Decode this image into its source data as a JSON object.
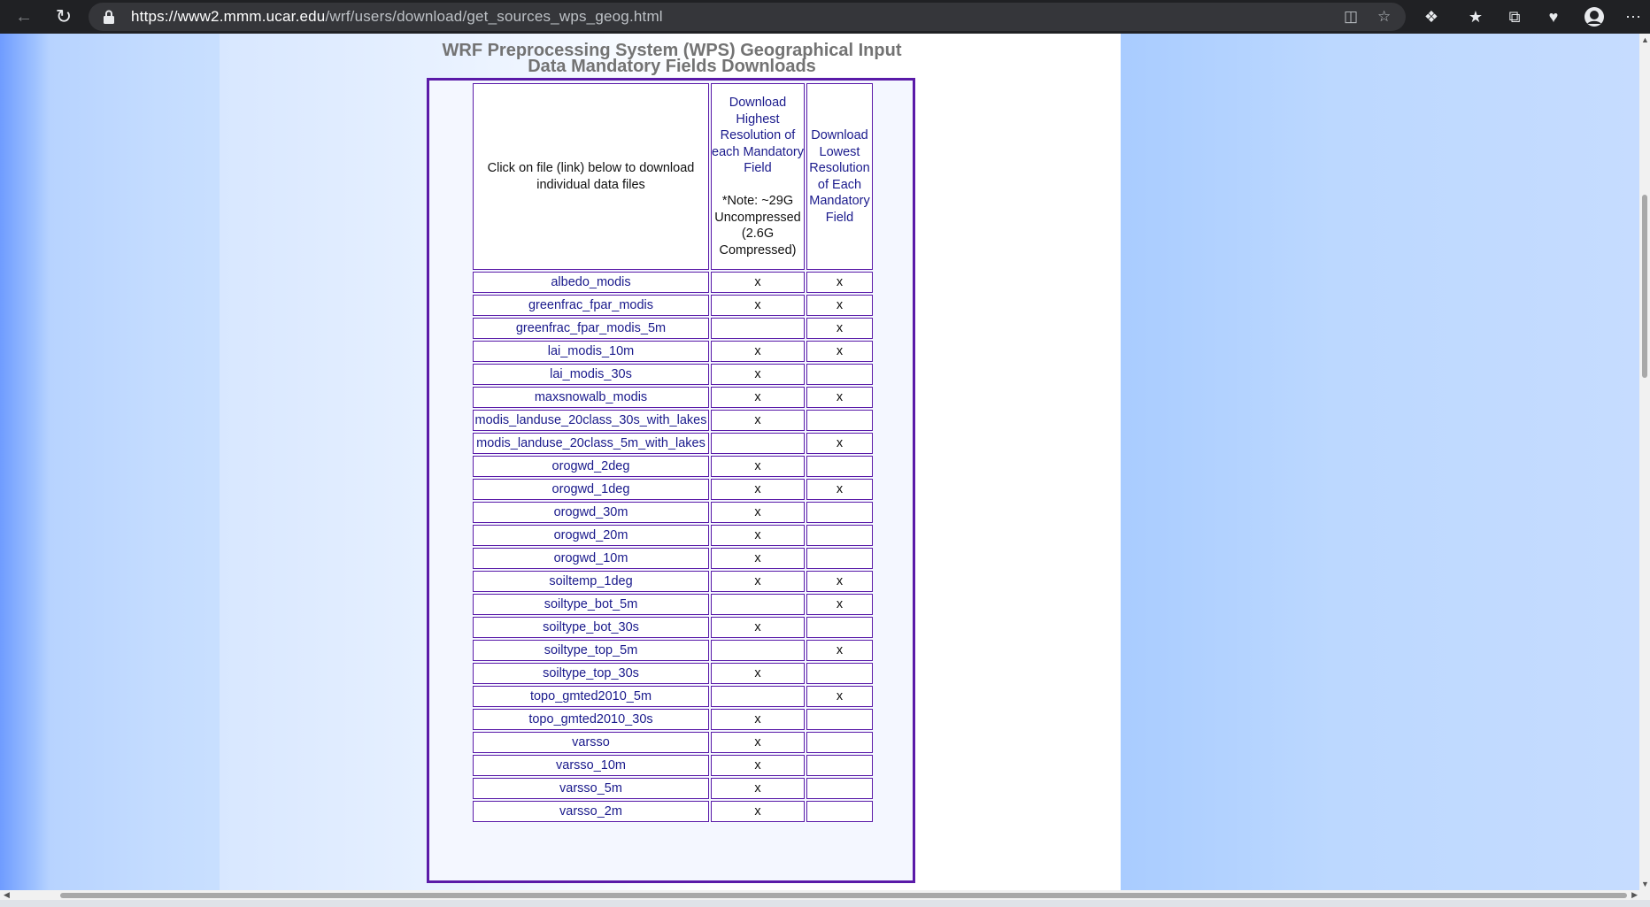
{
  "browser": {
    "url_host": "https://www2.mmm.ucar.edu",
    "url_path": "/wrf/users/download/get_sources_wps_geog.html"
  },
  "page": {
    "heading": "WRF Preprocessing System (WPS) Geographical Input Data Mandatory Fields Downloads",
    "table": {
      "header_file": "Click on file (link) below to download individual data files",
      "header_high": "Download Highest Resolution of each Mandatory Field",
      "header_high_note": "*Note: ~29G Uncompressed (2.6G Compressed)",
      "header_low": "Download Lowest Resolution of Each Mandatory Field",
      "rows": [
        {
          "name": "albedo_modis",
          "high": "x",
          "low": "x"
        },
        {
          "name": "greenfrac_fpar_modis",
          "high": "x",
          "low": "x"
        },
        {
          "name": "greenfrac_fpar_modis_5m",
          "high": "",
          "low": "x"
        },
        {
          "name": "lai_modis_10m",
          "high": "x",
          "low": "x"
        },
        {
          "name": "lai_modis_30s",
          "high": "x",
          "low": ""
        },
        {
          "name": "maxsnowalb_modis",
          "high": "x",
          "low": "x"
        },
        {
          "name": "modis_landuse_20class_30s_with_lakes",
          "high": "x",
          "low": ""
        },
        {
          "name": "modis_landuse_20class_5m_with_lakes",
          "high": "",
          "low": "x"
        },
        {
          "name": "orogwd_2deg",
          "high": "x",
          "low": ""
        },
        {
          "name": "orogwd_1deg",
          "high": "x",
          "low": "x"
        },
        {
          "name": "orogwd_30m",
          "high": "x",
          "low": ""
        },
        {
          "name": "orogwd_20m",
          "high": "x",
          "low": ""
        },
        {
          "name": "orogwd_10m",
          "high": "x",
          "low": ""
        },
        {
          "name": "soiltemp_1deg",
          "high": "x",
          "low": "x"
        },
        {
          "name": "soiltype_bot_5m",
          "high": "",
          "low": "x"
        },
        {
          "name": "soiltype_bot_30s",
          "high": "x",
          "low": ""
        },
        {
          "name": "soiltype_top_5m",
          "high": "",
          "low": "x"
        },
        {
          "name": "soiltype_top_30s",
          "high": "x",
          "low": ""
        },
        {
          "name": "topo_gmted2010_5m",
          "high": "",
          "low": "x"
        },
        {
          "name": "topo_gmted2010_30s",
          "high": "x",
          "low": ""
        },
        {
          "name": "varsso",
          "high": "x",
          "low": ""
        },
        {
          "name": "varsso_10m",
          "high": "x",
          "low": ""
        },
        {
          "name": "varsso_5m",
          "high": "x",
          "low": ""
        },
        {
          "name": "varsso_2m",
          "high": "x",
          "low": ""
        }
      ]
    }
  },
  "colors": {
    "link": "#1a1a8c",
    "table_border": "#5a1aa8",
    "heading": "#737373"
  }
}
